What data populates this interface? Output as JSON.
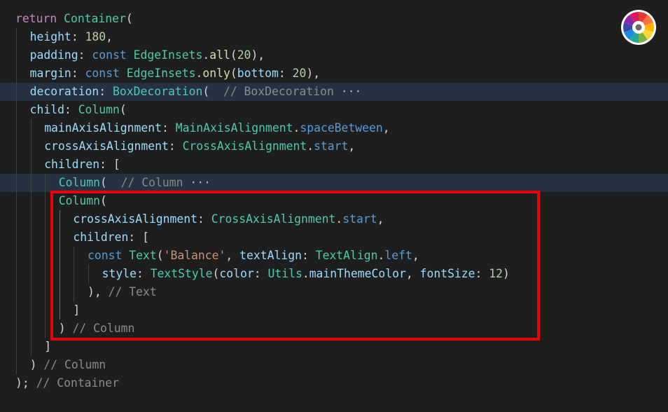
{
  "editor": {
    "lines": [
      {
        "tokens": [
          {
            "t": "return ",
            "c": "kw"
          },
          {
            "t": "Container",
            "c": "ty"
          },
          {
            "t": "(",
            "c": "pu"
          }
        ]
      },
      {
        "tokens": [
          {
            "t": "height",
            "c": "pr"
          },
          {
            "t": ": ",
            "c": "pu"
          },
          {
            "t": "180",
            "c": "num"
          },
          {
            "t": ",",
            "c": "pu"
          }
        ]
      },
      {
        "tokens": [
          {
            "t": "padding",
            "c": "pr"
          },
          {
            "t": ": ",
            "c": "pu"
          },
          {
            "t": "const ",
            "c": "kw2"
          },
          {
            "t": "EdgeInsets",
            "c": "ty"
          },
          {
            "t": ".",
            "c": "pu"
          },
          {
            "t": "all",
            "c": "fn"
          },
          {
            "t": "(",
            "c": "pu"
          },
          {
            "t": "20",
            "c": "num"
          },
          {
            "t": "),",
            "c": "pu"
          }
        ]
      },
      {
        "tokens": [
          {
            "t": "margin",
            "c": "pr"
          },
          {
            "t": ": ",
            "c": "pu"
          },
          {
            "t": "const ",
            "c": "kw2"
          },
          {
            "t": "EdgeInsets",
            "c": "ty"
          },
          {
            "t": ".",
            "c": "pu"
          },
          {
            "t": "only",
            "c": "fn"
          },
          {
            "t": "(",
            "c": "pu"
          },
          {
            "t": "bottom",
            "c": "pr"
          },
          {
            "t": ": ",
            "c": "pu"
          },
          {
            "t": "20",
            "c": "num"
          },
          {
            "t": "),",
            "c": "pu"
          }
        ]
      },
      {
        "tokens": [
          {
            "t": "decoration",
            "c": "pr"
          },
          {
            "t": ": ",
            "c": "pu"
          },
          {
            "t": "BoxDecoration",
            "c": "ty"
          },
          {
            "t": "( ",
            "c": "pu"
          },
          {
            "t": " // BoxDecoration ",
            "c": "cm"
          },
          {
            "t": "···",
            "c": "el"
          }
        ]
      },
      {
        "tokens": [
          {
            "t": "child",
            "c": "pr"
          },
          {
            "t": ": ",
            "c": "pu"
          },
          {
            "t": "Column",
            "c": "ty"
          },
          {
            "t": "(",
            "c": "pu"
          }
        ]
      },
      {
        "tokens": [
          {
            "t": "mainAxisAlignment",
            "c": "pr"
          },
          {
            "t": ": ",
            "c": "pu"
          },
          {
            "t": "MainAxisAlignment",
            "c": "ty"
          },
          {
            "t": ".",
            "c": "pu"
          },
          {
            "t": "spaceBetween",
            "c": "kw2"
          },
          {
            "t": ",",
            "c": "pu"
          }
        ]
      },
      {
        "tokens": [
          {
            "t": "crossAxisAlignment",
            "c": "pr"
          },
          {
            "t": ": ",
            "c": "pu"
          },
          {
            "t": "CrossAxisAlignment",
            "c": "ty"
          },
          {
            "t": ".",
            "c": "pu"
          },
          {
            "t": "start",
            "c": "kw2"
          },
          {
            "t": ",",
            "c": "pu"
          }
        ]
      },
      {
        "tokens": [
          {
            "t": "children",
            "c": "pr"
          },
          {
            "t": ": [",
            "c": "pu"
          }
        ]
      },
      {
        "tokens": [
          {
            "t": "Column",
            "c": "ty"
          },
          {
            "t": "( ",
            "c": "pu"
          },
          {
            "t": " // Column ",
            "c": "cm"
          },
          {
            "t": "···",
            "c": "el"
          }
        ]
      },
      {
        "tokens": [
          {
            "t": "Column",
            "c": "ty"
          },
          {
            "t": "(",
            "c": "pu"
          }
        ]
      },
      {
        "tokens": [
          {
            "t": "crossAxisAlignment",
            "c": "pr"
          },
          {
            "t": ": ",
            "c": "pu"
          },
          {
            "t": "CrossAxisAlignment",
            "c": "ty"
          },
          {
            "t": ".",
            "c": "pu"
          },
          {
            "t": "start",
            "c": "kw2"
          },
          {
            "t": ",",
            "c": "pu"
          }
        ]
      },
      {
        "tokens": [
          {
            "t": "children",
            "c": "pr"
          },
          {
            "t": ": [",
            "c": "pu"
          }
        ]
      },
      {
        "tokens": [
          {
            "t": "const ",
            "c": "kw2"
          },
          {
            "t": "Text",
            "c": "ty"
          },
          {
            "t": "(",
            "c": "pu"
          },
          {
            "t": "'Balance'",
            "c": "str"
          },
          {
            "t": ", ",
            "c": "pu"
          },
          {
            "t": "textAlign",
            "c": "pr"
          },
          {
            "t": ": ",
            "c": "pu"
          },
          {
            "t": "TextAlign",
            "c": "ty"
          },
          {
            "t": ".",
            "c": "pu"
          },
          {
            "t": "left",
            "c": "kw2"
          },
          {
            "t": ",",
            "c": "pu"
          }
        ]
      },
      {
        "tokens": [
          {
            "t": "style",
            "c": "pr"
          },
          {
            "t": ": ",
            "c": "pu"
          },
          {
            "t": "TextStyle",
            "c": "ty"
          },
          {
            "t": "(",
            "c": "pu"
          },
          {
            "t": "color",
            "c": "pr"
          },
          {
            "t": ": ",
            "c": "pu"
          },
          {
            "t": "Utils",
            "c": "ty"
          },
          {
            "t": ".",
            "c": "pu"
          },
          {
            "t": "mainThemeColor",
            "c": "pr"
          },
          {
            "t": ", ",
            "c": "pu"
          },
          {
            "t": "fontSize",
            "c": "pr"
          },
          {
            "t": ": ",
            "c": "pu"
          },
          {
            "t": "12",
            "c": "num"
          },
          {
            "t": ")",
            "c": "pu"
          }
        ]
      },
      {
        "tokens": [
          {
            "t": "), ",
            "c": "pu"
          },
          {
            "t": "// Text",
            "c": "cm"
          }
        ]
      },
      {
        "tokens": [
          {
            "t": "]",
            "c": "pu"
          }
        ]
      },
      {
        "tokens": [
          {
            "t": ") ",
            "c": "pu"
          },
          {
            "t": "// Column",
            "c": "cm"
          }
        ]
      },
      {
        "tokens": [
          {
            "t": "]",
            "c": "pu"
          }
        ]
      },
      {
        "tokens": [
          {
            "t": ") ",
            "c": "pu"
          },
          {
            "t": "// Column",
            "c": "cm"
          }
        ]
      },
      {
        "tokens": [
          {
            "t": "); ",
            "c": "pu"
          },
          {
            "t": "// Container",
            "c": "cm"
          }
        ]
      }
    ]
  },
  "annotation": {
    "color": "#e8000b"
  },
  "floating_icon": {
    "name": "color-wheel-icon"
  }
}
